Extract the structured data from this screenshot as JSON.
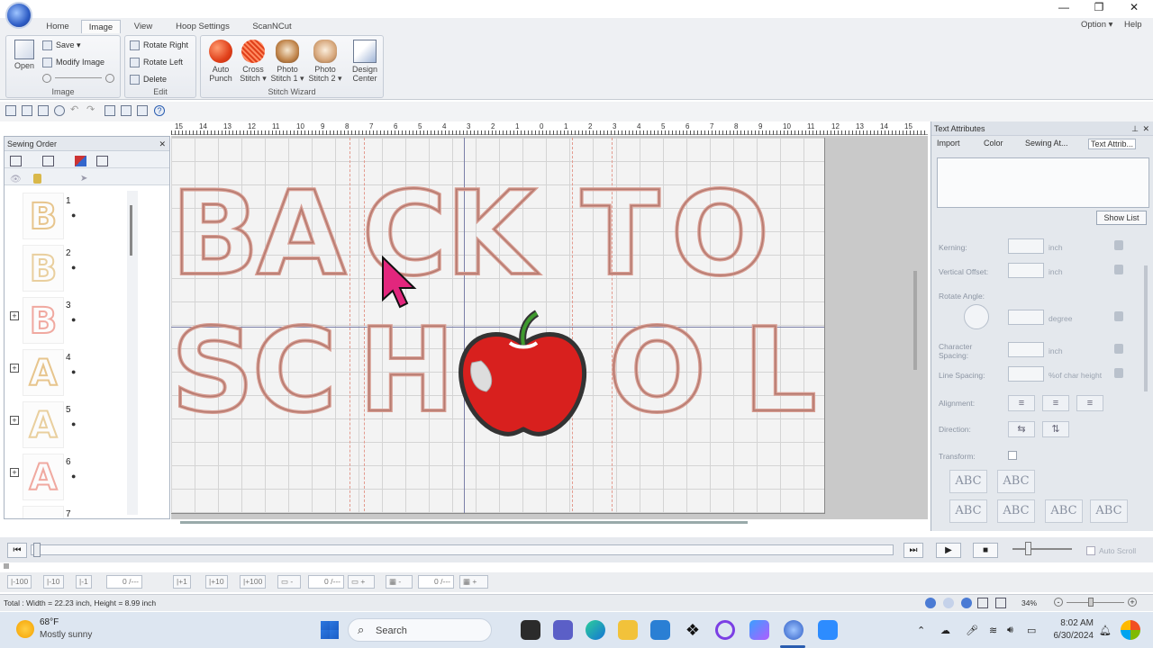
{
  "window": {
    "min_glyph": "—",
    "max_glyph": "❐",
    "close_glyph": "✕"
  },
  "tabs": [
    {
      "label": "Home"
    },
    {
      "label": "Image"
    },
    {
      "label": "View"
    },
    {
      "label": "Hoop Settings"
    },
    {
      "label": "ScanNCut"
    }
  ],
  "right_menu": {
    "option": "Option ▾",
    "help": "Help"
  },
  "ribbon": {
    "image_group": {
      "label": "Image",
      "open": "Open",
      "save": "Save ▾",
      "modify": "Modify Image"
    },
    "edit_group": {
      "label": "Edit",
      "rotate_right": "Rotate Right",
      "rotate_left": "Rotate Left",
      "delete": "Delete"
    },
    "stitch_group": {
      "label": "Stitch Wizard",
      "auto_punch": [
        "Auto",
        "Punch"
      ],
      "cross_stitch": [
        "Cross",
        "Stitch ▾"
      ],
      "photo1": [
        "Photo",
        "Stitch 1 ▾"
      ],
      "photo2": [
        "Photo",
        "Stitch 2 ▾"
      ],
      "design_center": [
        "Design",
        "Center"
      ]
    }
  },
  "ruler": [
    "15",
    "14",
    "13",
    "12",
    "11",
    "10",
    "9",
    "8",
    "7",
    "6",
    "5",
    "4",
    "3",
    "2",
    "1",
    "0",
    "1",
    "2",
    "3",
    "4",
    "5",
    "6",
    "7",
    "8",
    "9",
    "10",
    "11",
    "12",
    "13",
    "14",
    "15"
  ],
  "sewing_order": {
    "title": "Sewing Order",
    "items": [
      {
        "num": "1",
        "letter": "B",
        "color": "#e7c58d",
        "expand": ""
      },
      {
        "num": "2",
        "letter": "B",
        "color": "#e9cf9e",
        "expand": ""
      },
      {
        "num": "3",
        "letter": "B",
        "color": "#f0a9a0",
        "expand": "+"
      },
      {
        "num": "4",
        "letter": "A",
        "color": "#e7c58d",
        "expand": "+"
      },
      {
        "num": "5",
        "letter": "A",
        "color": "#e9cf9e",
        "expand": "+"
      },
      {
        "num": "6",
        "letter": "A",
        "color": "#f0a9a0",
        "expand": "+"
      },
      {
        "num": "7",
        "letter": "",
        "color": "#e9cf9e",
        "expand": ""
      }
    ]
  },
  "design": {
    "line1": [
      "B",
      "A",
      "C",
      "K",
      "T",
      "O"
    ],
    "line2": [
      "S",
      "C",
      "H",
      "O",
      "L"
    ]
  },
  "text_attributes": {
    "title": "Text Attributes",
    "tabs": [
      "Import",
      "Color",
      "Sewing At...",
      "Text Attrib..."
    ],
    "show_list": "Show List",
    "kerning": "Kerning:",
    "kerning_unit": "inch",
    "voffset": "Vertical Offset:",
    "voffset_unit": "inch",
    "rotate": "Rotate Angle:",
    "rotate_unit": "degree",
    "charspacing": "Character Spacing:",
    "charspacing_unit": "inch",
    "linespacing": "Line Spacing:",
    "linespacing_unit": "%of char height",
    "alignment": "Alignment:",
    "direction": "Direction:",
    "transform": "Transform:",
    "abc": "ABC"
  },
  "player": {
    "auto_scroll": "Auto Scroll"
  },
  "stepbar": {
    "b1": "|-100",
    "b2": "|-10",
    "b3": "|-1",
    "f1": "0 /---",
    "b4": "|+1",
    "b5": "|+10",
    "b6": "|+100",
    "f2": "0 /---",
    "f3": "0 /---"
  },
  "status": {
    "size": "Total : Width = 22.23 inch, Height = 8.99 inch",
    "zoom": "34%"
  },
  "taskbar": {
    "temp": "68°F",
    "weather": "Mostly sunny",
    "search": "Search",
    "time": "8:02 AM",
    "date": "6/30/2024"
  }
}
